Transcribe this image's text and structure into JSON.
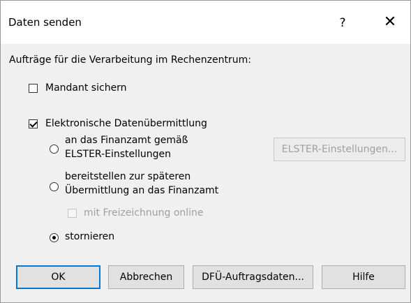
{
  "window": {
    "title": "Daten senden",
    "help_glyph": "?",
    "close_glyph": "✕"
  },
  "main": {
    "section_label": "Aufträge für die Verarbeitung im Rechenzentrum:",
    "mandant_sichern": {
      "label": "Mandant sichern",
      "checked": false
    },
    "elektronische": {
      "label": "Elektronische Datenübermittlung",
      "checked": true
    },
    "radio_finanzamt": {
      "line1": "an das Finanzamt gemäß",
      "line2": "ELSTER-Einstellungen",
      "selected": false
    },
    "radio_bereitstellen": {
      "line1": "bereitstellen zur späteren",
      "line2": "Übermittlung an das Finanzamt",
      "selected": false
    },
    "freizeichnung": {
      "label": "mit Freizeichnung online",
      "checked": false,
      "enabled": false
    },
    "radio_stornieren": {
      "label": "stornieren",
      "selected": true
    },
    "elster_button": {
      "label": "ELSTER-Einstellungen...",
      "enabled": false
    }
  },
  "footer": {
    "ok": "OK",
    "abbrechen": "Abbrechen",
    "dfue": "DFÜ-Auftragsdaten...",
    "hilfe": "Hilfe"
  },
  "colors": {
    "focus_border": "#0078d7",
    "disabled_text": "#a0a0a0"
  }
}
